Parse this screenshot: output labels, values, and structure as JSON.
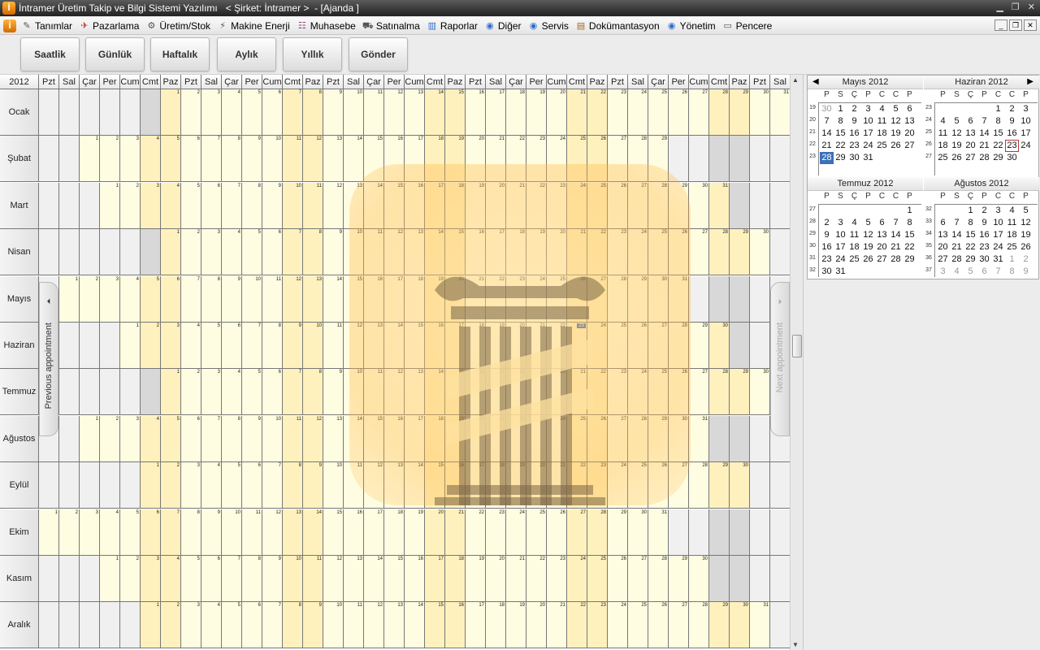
{
  "window": {
    "title": "İntramer Üretim Takip ve Bilgi Sistemi Yazılımı   < Şirket: İntramer >  - [Ajanda ]",
    "icon": "app-logo-icon"
  },
  "menu": [
    {
      "label": "Tanımlar",
      "icon": "definitions-icon"
    },
    {
      "label": "Pazarlama",
      "icon": "marketing-icon"
    },
    {
      "label": "Üretim/Stok",
      "icon": "production-stock-icon"
    },
    {
      "label": "Makine Enerji",
      "icon": "machine-energy-icon"
    },
    {
      "label": "Muhasebe",
      "icon": "accounting-icon"
    },
    {
      "label": "Satınalma",
      "icon": "purchasing-icon"
    },
    {
      "label": "Raporlar",
      "icon": "reports-icon"
    },
    {
      "label": "Diğer",
      "icon": "globe-icon"
    },
    {
      "label": "Servis",
      "icon": "globe-icon"
    },
    {
      "label": "Dokümantasyon",
      "icon": "documentation-icon"
    },
    {
      "label": "Yönetim",
      "icon": "globe-icon"
    },
    {
      "label": "Pencere",
      "icon": "window-icon"
    }
  ],
  "toolbar": {
    "buttons": [
      "Saatlik",
      "Günlük",
      "Haftalık",
      "Aylık",
      "Yıllık",
      "Gönder"
    ]
  },
  "calendar": {
    "year": "2012",
    "weekday_headers": [
      "Pzt",
      "Sal",
      "Çar",
      "Per",
      "Cum",
      "Cmt",
      "Paz",
      "Pzt",
      "Sal",
      "Çar",
      "Per",
      "Cum",
      "Cmt",
      "Paz",
      "Pzt",
      "Sal",
      "Çar",
      "Per",
      "Cum",
      "Cmt",
      "Paz",
      "Pzt",
      "Sal",
      "Çar",
      "Per",
      "Cum",
      "Cmt",
      "Paz",
      "Pzt",
      "Sal",
      "Çar",
      "Per",
      "Cum",
      "Cmt",
      "Paz",
      "Pzt",
      "Sal"
    ],
    "months": [
      {
        "name": "Ocak",
        "offset": 6,
        "days": 31
      },
      {
        "name": "Şubat",
        "offset": 2,
        "days": 29
      },
      {
        "name": "Mart",
        "offset": 3,
        "days": 31
      },
      {
        "name": "Nisan",
        "offset": 6,
        "days": 30
      },
      {
        "name": "Mayıs",
        "offset": 1,
        "days": 31
      },
      {
        "name": "Haziran",
        "offset": 4,
        "days": 30
      },
      {
        "name": "Temmuz",
        "offset": 6,
        "days": 31
      },
      {
        "name": "Ağustos",
        "offset": 2,
        "days": 31
      },
      {
        "name": "Eylül",
        "offset": 5,
        "days": 30
      },
      {
        "name": "Ekim",
        "offset": 0,
        "days": 31
      },
      {
        "name": "Kasım",
        "offset": 3,
        "days": 30
      },
      {
        "name": "Aralık",
        "offset": 5,
        "days": 31
      }
    ],
    "today": {
      "month": 6,
      "day": 23
    },
    "prev_label": "Previous appointment",
    "next_label": "Next appointment",
    "colors": {
      "weekday": "#fffde1",
      "weekend": "#fff1bd",
      "empty": "#f0f0f0",
      "empty_dark": "#d8d8d8",
      "today": "#2a5da7"
    }
  },
  "minical": {
    "dow": [
      "P",
      "S",
      "Ç",
      "P",
      "C",
      "C",
      "P"
    ],
    "months": [
      {
        "title": "Mayıs 2012",
        "weeks": [
          "19",
          "20",
          "21",
          "22",
          "23"
        ],
        "days": [
          [
            "30",
            "o"
          ],
          [
            "1"
          ],
          [
            "2"
          ],
          [
            "3"
          ],
          [
            "4"
          ],
          [
            "5"
          ],
          [
            "6"
          ],
          [
            "7"
          ],
          [
            "8"
          ],
          [
            "9"
          ],
          [
            "10"
          ],
          [
            "11"
          ],
          [
            "12"
          ],
          [
            "13"
          ],
          [
            "14"
          ],
          [
            "15"
          ],
          [
            "16"
          ],
          [
            "17"
          ],
          [
            "18"
          ],
          [
            "19"
          ],
          [
            "20"
          ],
          [
            "21"
          ],
          [
            "22"
          ],
          [
            "23"
          ],
          [
            "24"
          ],
          [
            "25"
          ],
          [
            "26"
          ],
          [
            "27"
          ],
          [
            "28",
            "sel"
          ],
          [
            "29"
          ],
          [
            "30"
          ],
          [
            "31"
          ]
        ]
      },
      {
        "title": "Haziran 2012",
        "weeks": [
          "23",
          "24",
          "25",
          "26",
          "27"
        ],
        "days": [
          [
            "",
            ""
          ],
          [
            "",
            ""
          ],
          [
            "",
            ""
          ],
          [
            "",
            ""
          ],
          [
            "1"
          ],
          [
            "2"
          ],
          [
            "3"
          ],
          [
            "4"
          ],
          [
            "5"
          ],
          [
            "6"
          ],
          [
            "7"
          ],
          [
            "8"
          ],
          [
            "9"
          ],
          [
            "10"
          ],
          [
            "11"
          ],
          [
            "12"
          ],
          [
            "13"
          ],
          [
            "14"
          ],
          [
            "15"
          ],
          [
            "16"
          ],
          [
            "17"
          ],
          [
            "18"
          ],
          [
            "19"
          ],
          [
            "20"
          ],
          [
            "21"
          ],
          [
            "22"
          ],
          [
            "23",
            "td"
          ],
          [
            "24"
          ],
          [
            "25"
          ],
          [
            "26"
          ],
          [
            "27"
          ],
          [
            "28"
          ],
          [
            "29"
          ],
          [
            "30"
          ]
        ]
      },
      {
        "title": "Temmuz 2012",
        "weeks": [
          "27",
          "28",
          "29",
          "30",
          "31",
          "32"
        ],
        "days": [
          [
            "",
            ""
          ],
          [
            "",
            ""
          ],
          [
            "",
            ""
          ],
          [
            "",
            ""
          ],
          [
            "",
            ""
          ],
          [
            "",
            ""
          ],
          [
            "1"
          ],
          [
            "2"
          ],
          [
            "3"
          ],
          [
            "4"
          ],
          [
            "5"
          ],
          [
            "6"
          ],
          [
            "7"
          ],
          [
            "8"
          ],
          [
            "9"
          ],
          [
            "10"
          ],
          [
            "11"
          ],
          [
            "12"
          ],
          [
            "13"
          ],
          [
            "14"
          ],
          [
            "15"
          ],
          [
            "16"
          ],
          [
            "17"
          ],
          [
            "18"
          ],
          [
            "19"
          ],
          [
            "20"
          ],
          [
            "21"
          ],
          [
            "22"
          ],
          [
            "23"
          ],
          [
            "24"
          ],
          [
            "25"
          ],
          [
            "26"
          ],
          [
            "27"
          ],
          [
            "28"
          ],
          [
            "29"
          ],
          [
            "30"
          ],
          [
            "31"
          ]
        ]
      },
      {
        "title": "Ağustos 2012",
        "weeks": [
          "32",
          "33",
          "34",
          "35",
          "36",
          "37"
        ],
        "days": [
          [
            "",
            ""
          ],
          [
            "",
            ""
          ],
          [
            "1"
          ],
          [
            "2"
          ],
          [
            "3"
          ],
          [
            "4"
          ],
          [
            "5"
          ],
          [
            "6"
          ],
          [
            "7"
          ],
          [
            "8"
          ],
          [
            "9"
          ],
          [
            "10"
          ],
          [
            "11"
          ],
          [
            "12"
          ],
          [
            "13"
          ],
          [
            "14"
          ],
          [
            "15"
          ],
          [
            "16"
          ],
          [
            "17"
          ],
          [
            "18"
          ],
          [
            "19"
          ],
          [
            "20"
          ],
          [
            "21"
          ],
          [
            "22"
          ],
          [
            "23"
          ],
          [
            "24"
          ],
          [
            "25"
          ],
          [
            "26"
          ],
          [
            "27"
          ],
          [
            "28"
          ],
          [
            "29"
          ],
          [
            "30"
          ],
          [
            "31"
          ],
          [
            "1",
            "o"
          ],
          [
            "2",
            "o"
          ],
          [
            "3",
            "o"
          ],
          [
            "4",
            "o"
          ],
          [
            "5",
            "o"
          ],
          [
            "6",
            "o"
          ],
          [
            "7",
            "o"
          ],
          [
            "8",
            "o"
          ],
          [
            "9",
            "o"
          ]
        ]
      }
    ]
  }
}
